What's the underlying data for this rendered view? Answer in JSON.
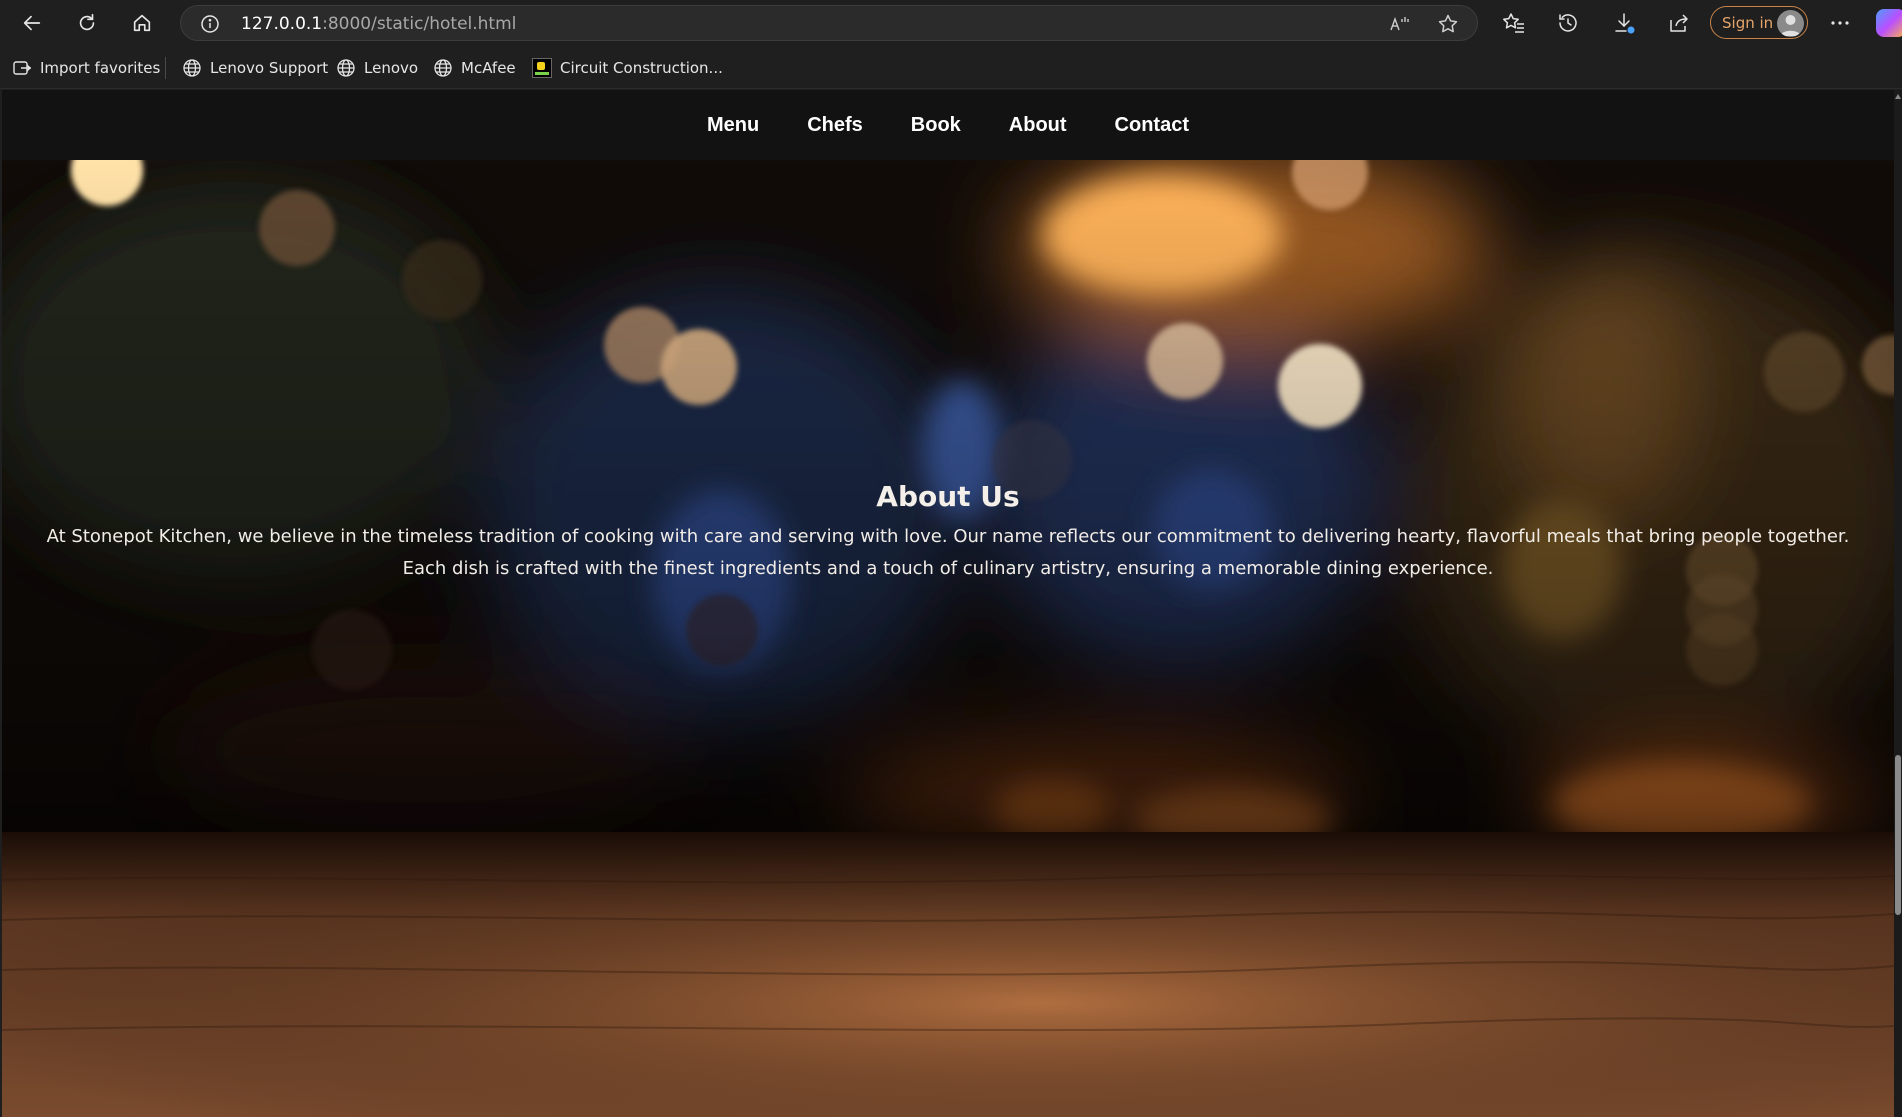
{
  "browser": {
    "url_host": "127.0.0.1",
    "url_path": ":8000/static/hotel.html",
    "sign_in_label": "Sign in",
    "favorites": [
      {
        "label": "Import favorites",
        "icon": "import-icon"
      },
      {
        "label": "Lenovo Support",
        "icon": "globe-icon"
      },
      {
        "label": "Lenovo",
        "icon": "globe-icon"
      },
      {
        "label": "McAfee",
        "icon": "globe-icon"
      },
      {
        "label": "Circuit Construction...",
        "icon": "phet-icon"
      }
    ]
  },
  "site": {
    "nav": [
      "Menu",
      "Chefs",
      "Book",
      "About",
      "Contact"
    ],
    "about": {
      "title": "About Us",
      "text": "At Stonepot Kitchen, we believe in the timeless tradition of cooking with care and serving with love. Our name reflects our commitment to delivering hearty, flavorful meals that bring people together. Each dish is crafted with the finest ingredients and a touch of culinary artistry, ensuring a memorable dining experience."
    }
  },
  "colors": {
    "nav_background": "#121212",
    "signin_accent": "#e7a56a",
    "bokeh_warm": "#ffb35a",
    "bokeh_cool": "#3a5aa0"
  }
}
